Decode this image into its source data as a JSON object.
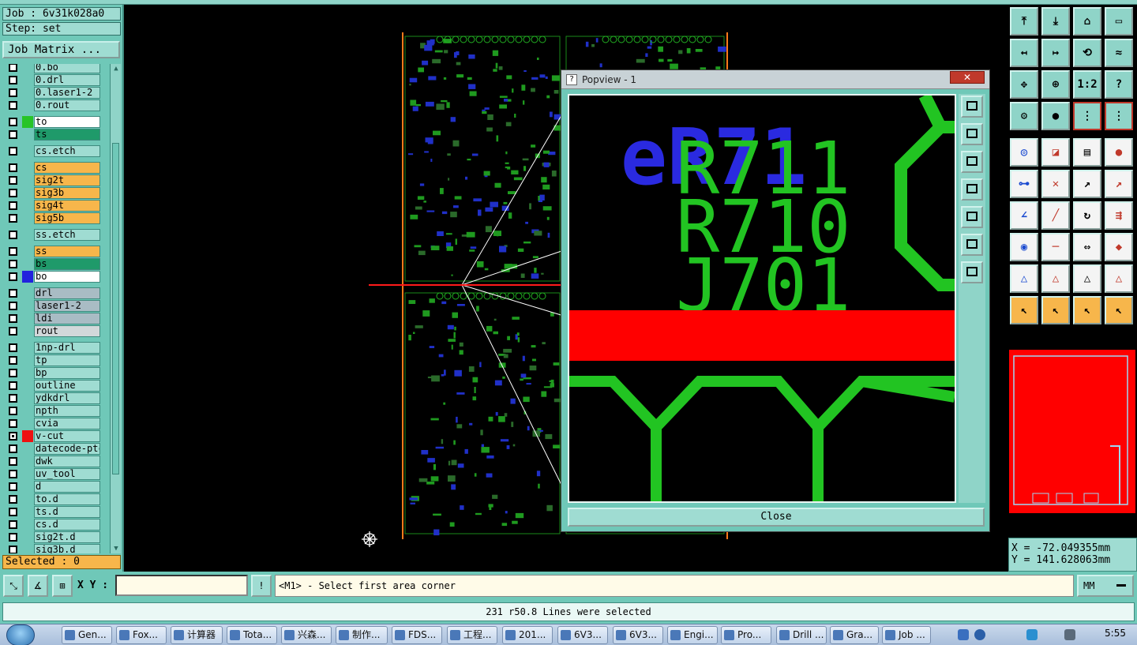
{
  "job": {
    "job_line": "Job : 6v31k028a0",
    "step_line": "Step: set",
    "matrix_button": "Job Matrix ..."
  },
  "layers": [
    {
      "name": "0.bo",
      "style": "plain"
    },
    {
      "name": "0.drl",
      "style": "plain"
    },
    {
      "name": "0.laser1-2",
      "style": "plain"
    },
    {
      "name": "0.rout",
      "style": "plain"
    },
    {
      "name": "to",
      "style": "white",
      "color": "#27c427"
    },
    {
      "name": "ts",
      "style": "teal"
    },
    {
      "name": "cs.etch",
      "style": "plain"
    },
    {
      "name": "cs",
      "style": "orange"
    },
    {
      "name": "sig2t",
      "style": "orange"
    },
    {
      "name": "sig3b",
      "style": "orange"
    },
    {
      "name": "sig4t",
      "style": "orange"
    },
    {
      "name": "sig5b",
      "style": "orange"
    },
    {
      "name": "ss.etch",
      "style": "plain"
    },
    {
      "name": "ss",
      "style": "orange"
    },
    {
      "name": "bs",
      "style": "teal"
    },
    {
      "name": "bo",
      "style": "white",
      "color": "#2222dd"
    },
    {
      "name": "drl",
      "style": "grey"
    },
    {
      "name": "laser1-2",
      "style": "grey"
    },
    {
      "name": "ldi",
      "style": "grey"
    },
    {
      "name": "rout",
      "style": "lgrey"
    },
    {
      "name": "1np-drl",
      "style": "plain"
    },
    {
      "name": "tp",
      "style": "plain"
    },
    {
      "name": "bp",
      "style": "plain"
    },
    {
      "name": "outline",
      "style": "plain"
    },
    {
      "name": "ydkdrl",
      "style": "plain"
    },
    {
      "name": "npth",
      "style": "plain"
    },
    {
      "name": "cvia",
      "style": "plain"
    },
    {
      "name": "v-cut",
      "style": "plain",
      "color": "#ee1111",
      "active": true
    },
    {
      "name": "datecode-ptc",
      "style": "plain"
    },
    {
      "name": "dwk",
      "style": "plain"
    },
    {
      "name": "uv_tool",
      "style": "plain"
    },
    {
      "name": "d",
      "style": "plain"
    },
    {
      "name": "to.d",
      "style": "plain"
    },
    {
      "name": "ts.d",
      "style": "plain"
    },
    {
      "name": "cs.d",
      "style": "plain"
    },
    {
      "name": "sig2t.d",
      "style": "plain"
    },
    {
      "name": "sig3b.d",
      "style": "plain"
    }
  ],
  "selected_count": "Selected : 0",
  "popview": {
    "title": "Popview - 1",
    "close_label": "Close",
    "glyph_texts": [
      "R711",
      "R710",
      "J701",
      "eR71"
    ]
  },
  "coords": {
    "x": "X = -72.049355mm",
    "y": "Y = 141.628063mm"
  },
  "command": {
    "xy_label": "X Y :",
    "xy_value": "",
    "prompt": "<M1> - Select first area corner",
    "unit": "MM"
  },
  "status_message": "231 r50.8 Lines were selected",
  "taskbar": {
    "tasks": [
      "Gen...",
      "Fox...",
      "计算器",
      "Tota...",
      "兴森...",
      "制作...",
      "FDS...",
      "工程...",
      "201...",
      "6V3...",
      "6V3...",
      "Engi...",
      "Pro...",
      "Drill ...",
      "Gra...",
      "Job ..."
    ],
    "clock": "5:55"
  },
  "colors": {
    "panel": "#6fc8b8",
    "field": "#9fdcd2",
    "signal": "#f7b64b",
    "board_green": "#22c422",
    "board_blue": "#2a2ae0",
    "vcut_red": "#ff0000"
  }
}
